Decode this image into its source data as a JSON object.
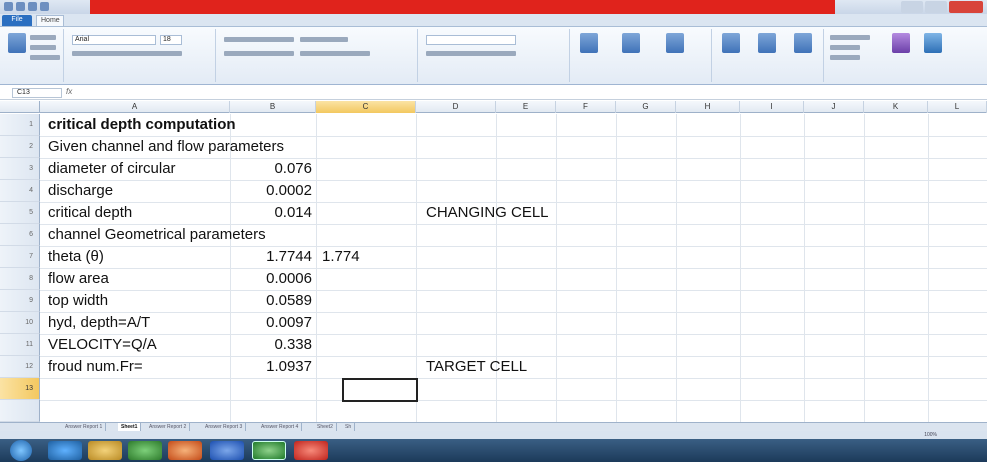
{
  "titlebar": {
    "title": "",
    "accent": "#e0231c"
  },
  "ribbon": {
    "tabs": [
      "File",
      "Home"
    ],
    "font_name": "Arial",
    "font_size": "18"
  },
  "formula_bar": {
    "name_box": "C13",
    "fx_label": "fx",
    "content": ""
  },
  "columns": [
    "A",
    "B",
    "C",
    "D",
    "E",
    "F",
    "G",
    "H",
    "I",
    "J",
    "K",
    "L"
  ],
  "rows": [
    "1",
    "2",
    "3",
    "4",
    "5",
    "6",
    "7",
    "8",
    "9",
    "10",
    "11",
    "12",
    "13"
  ],
  "cells": {
    "A1": "critical depth computation",
    "A2": "Given channel and flow parameters",
    "A3": "diameter of circular",
    "B3": "0.076",
    "A4": "discharge",
    "B4": "0.0002",
    "A5": "critical depth",
    "B5": "0.014",
    "D5": "CHANGING CELL",
    "A6": "channel Geometrical parameters",
    "A7": "theta (θ)",
    "B7": "1.7744",
    "C7": "1.774",
    "A8": "flow area",
    "B8": "0.0006",
    "A9": "top width",
    "B9": "0.0589",
    "A10": "hyd, depth=A/T",
    "B10": "0.0097",
    "A11": "VELOCITY=Q/A",
    "B11": "0.338",
    "A12": "froud num.Fr=",
    "B12": "1.0937",
    "D12": "TARGET CELL"
  },
  "active_cell": "C13",
  "sheet_tabs": [
    "Answer Report 1",
    "Sheet1",
    "Answer Report 2",
    "Answer Report 3",
    "Answer Report 4",
    "Sheet2",
    "Sh"
  ],
  "active_sheet": "Sheet1",
  "status": {
    "zoom": "100%"
  }
}
